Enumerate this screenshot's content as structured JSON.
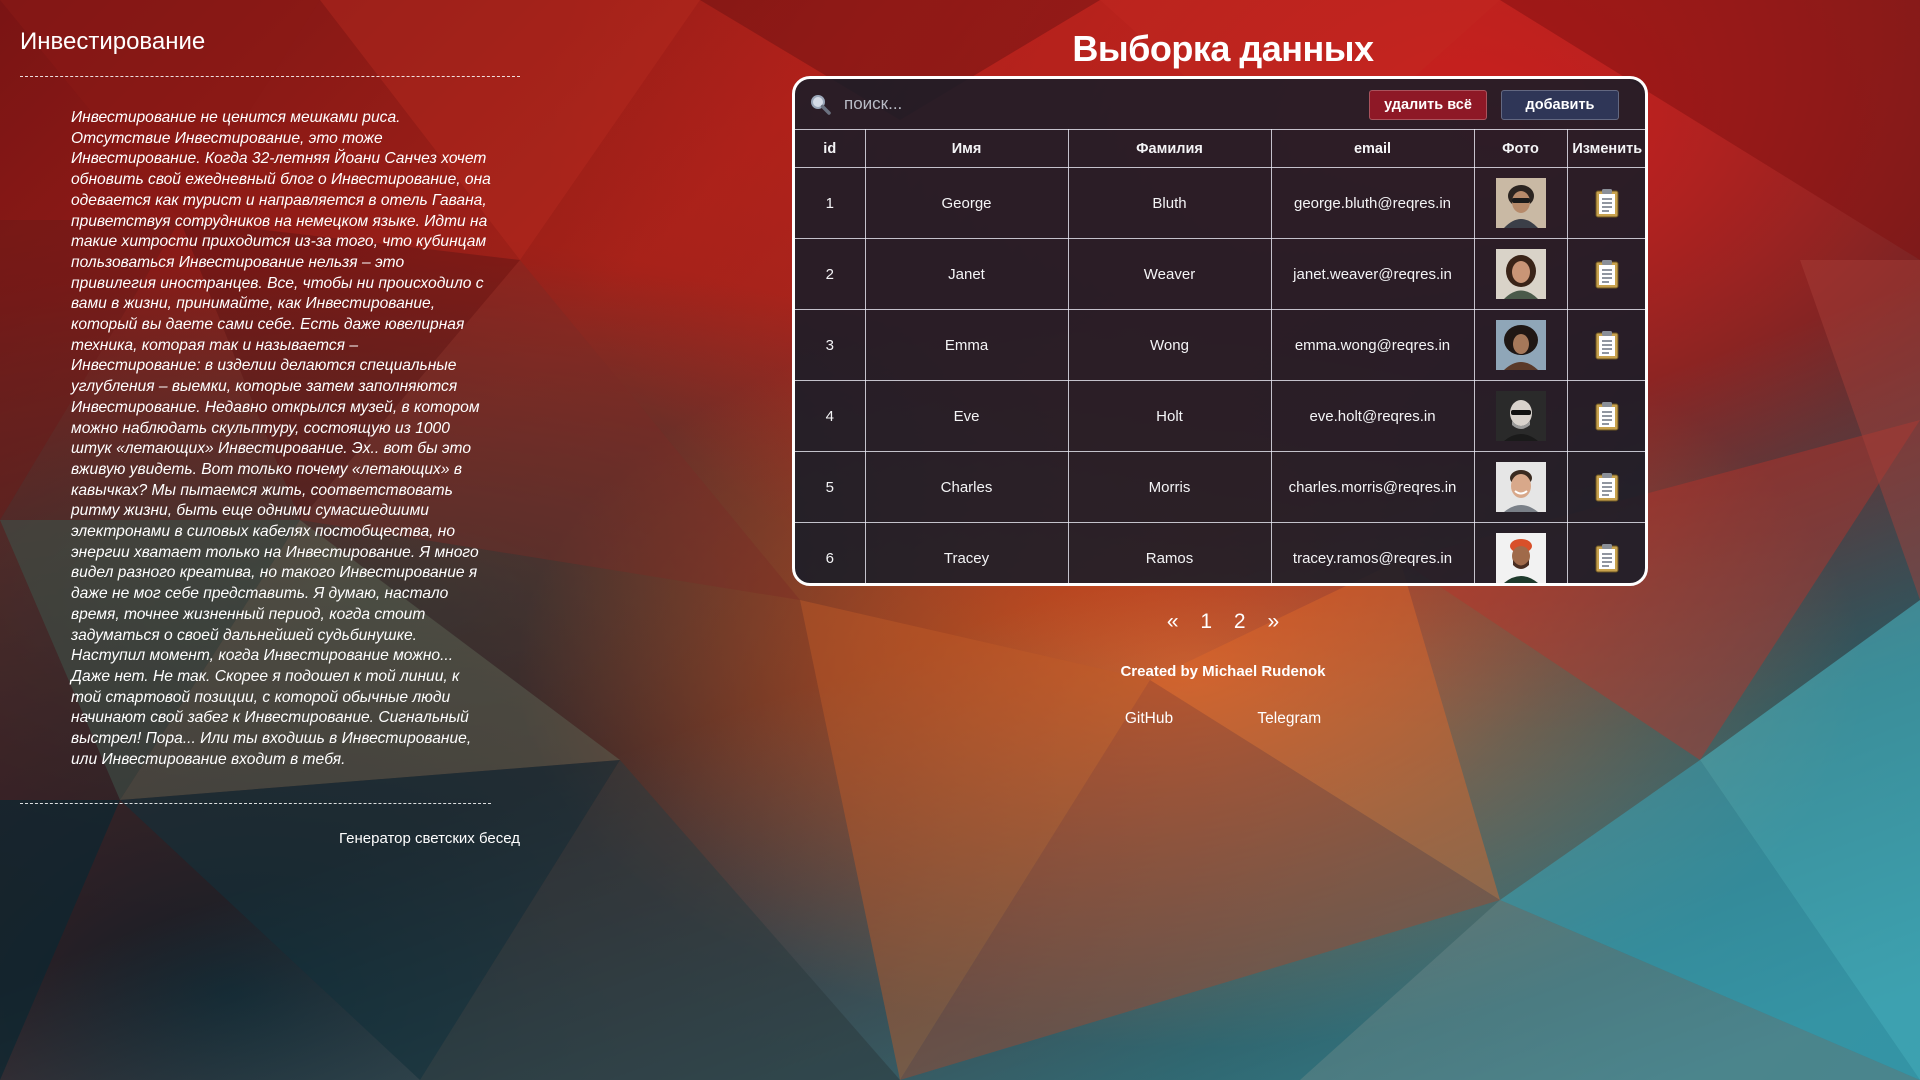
{
  "article": {
    "title": "Инвестирование",
    "body": "Инвестирование не ценится мешками риса. Отсутствие Инвестирование, это тоже Инвестирование. Когда 32-летняя Йоани Санчез хочет обновить свой ежедневный блог о Инвестирование, она одевается как турист и направляется в отель Гавана, приветствуя сотрудников на немецком языке. Идти на такие хитрости приходится из-за того, что кубинцам пользоваться Инвестирование нельзя – это привилегия иностранцев. Все, чтобы ни происходило с вами в жизни, принимайте, как Инвестирование, который вы даете сами себе. Есть даже ювелирная техника, которая так и называется – Инвестирование: в изделии делаются специальные углубления – выемки, которые затем заполняются Инвестирование. Недавно открылся музей, в котором можно наблюдать скульптуру, состоящую из 1000 штук «летающих» Инвестирование. Эх.. вот бы это вживую увидеть. Вот только почему «летающих» в кавычках? Мы пытаемся жить, соответствовать ритму жизни, быть еще одними сумасшедшими электронами в силовых кабелях постобщества, но энергии хватает только на Инвестирование. Я много видел разного креатива, но такого Инвестирование я даже не мог себе представить. Я думаю, настало время, точнее жизненный период, когда стоит задуматься о своей дальнейшей судьбинушке. Наступил момент, когда Инвестирование можно... Даже нет. Не так. Скорее я подошел к той линии, к той стартовой позиции, с которой обычные люди начинают свой забег к Инвестирование. Сигнальный выстрел! Пора... Или ты входишь в Инвестирование, или Инвестирование входит в тебя.",
    "footer": "Генератор светских бесед"
  },
  "panel": {
    "title": "Выборка данных",
    "search_placeholder": "поиск...",
    "search_icon": "magnifier-icon",
    "delete_all_label": "удалить всё",
    "add_label": "добавить",
    "colors": {
      "delete_button": "#8e1826",
      "add_button": "#2f3657",
      "card_background": "#181c28"
    }
  },
  "table": {
    "headers": {
      "id": "id",
      "first_name": "Имя",
      "last_name": "Фамилия",
      "email": "email",
      "photo": "Фото",
      "edit": "Изменить"
    },
    "rows": [
      {
        "id": "1",
        "first_name": "George",
        "last_name": "Bluth",
        "email": "george.bluth@reqres.in",
        "photo": "avatar-george",
        "edit_icon": "clipboard-icon"
      },
      {
        "id": "2",
        "first_name": "Janet",
        "last_name": "Weaver",
        "email": "janet.weaver@reqres.in",
        "photo": "avatar-janet",
        "edit_icon": "clipboard-icon"
      },
      {
        "id": "3",
        "first_name": "Emma",
        "last_name": "Wong",
        "email": "emma.wong@reqres.in",
        "photo": "avatar-emma",
        "edit_icon": "clipboard-icon"
      },
      {
        "id": "4",
        "first_name": "Eve",
        "last_name": "Holt",
        "email": "eve.holt@reqres.in",
        "photo": "avatar-eve",
        "edit_icon": "clipboard-icon"
      },
      {
        "id": "5",
        "first_name": "Charles",
        "last_name": "Morris",
        "email": "charles.morris@reqres.in",
        "photo": "avatar-charles",
        "edit_icon": "clipboard-icon"
      },
      {
        "id": "6",
        "first_name": "Tracey",
        "last_name": "Ramos",
        "email": "tracey.ramos@reqres.in",
        "photo": "avatar-tracey",
        "edit_icon": "clipboard-icon"
      }
    ]
  },
  "pagination": {
    "prev": "«",
    "pages": [
      "1",
      "2"
    ],
    "next": "»"
  },
  "credits": "Created by Michael Rudenok",
  "links": {
    "github": "GitHub",
    "telegram": "Telegram"
  }
}
